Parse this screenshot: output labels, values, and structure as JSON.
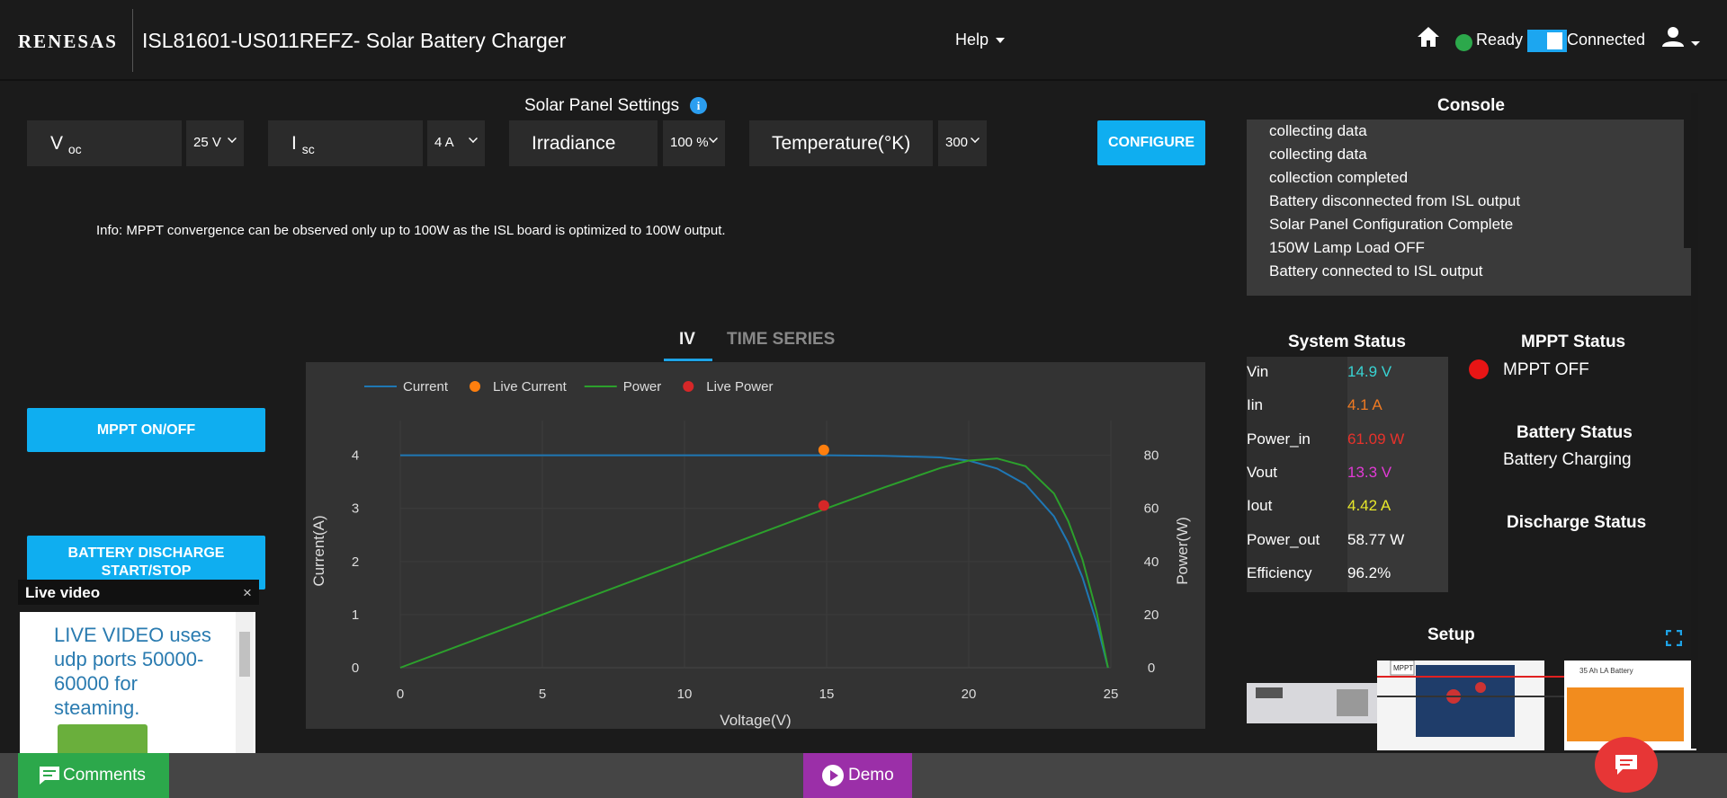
{
  "header": {
    "logo": "RENESAS",
    "title": "ISL81601-US011REFZ- Solar Battery Charger",
    "help_label": "Help",
    "ready_label": "Ready",
    "connected_label": "Connected"
  },
  "panel": {
    "title": "Solar Panel Settings",
    "voc_label": "V",
    "voc_sub": "oc",
    "voc_value": "25 V",
    "isc_label": "I",
    "isc_sub": "sc",
    "isc_value": "4 A",
    "irradiance_label": "Irradiance",
    "irradiance_value": "100 %",
    "temp_label": "Temperature(°K)",
    "temp_value": "300",
    "configure_label": "CONFIGURE",
    "info": "Info: MPPT convergence can be observed only up to 100W as the ISL board is optimized to 100W output."
  },
  "console": {
    "title": "Console",
    "lines": [
      "collecting data",
      "collecting data",
      "collection completed",
      "Battery disconnected from ISL output",
      "Solar Panel Configuration Complete",
      "150W Lamp Load OFF",
      "Battery connected to ISL output"
    ]
  },
  "tabs": {
    "iv": "IV",
    "time_series": "TIME SERIES"
  },
  "buttons": {
    "mppt": "MPPT ON/OFF",
    "discharge_line1": "BATTERY DISCHARGE",
    "discharge_line2": "START/STOP"
  },
  "live_video": {
    "title": "Live video",
    "close": "×",
    "text": "LIVE VIDEO uses udp ports 50000-60000 for steaming."
  },
  "system_status": {
    "title": "System Status",
    "rows": [
      {
        "label": "Vin",
        "value": "14.9 V",
        "color": "#38d4d4"
      },
      {
        "label": "Iin",
        "value": "4.1 A",
        "color": "#f07a22"
      },
      {
        "label": "Power_in",
        "value": "61.09 W",
        "color": "#e8322b"
      },
      {
        "label": "Vout",
        "value": "13.3 V",
        "color": "#e23ad6"
      },
      {
        "label": "Iout",
        "value": "4.42 A",
        "color": "#e8e82a"
      },
      {
        "label": "Power_out",
        "value": "58.77 W",
        "color": "#ffffff"
      },
      {
        "label": "Efficiency",
        "value": "96.2%",
        "color": "#ffffff"
      }
    ]
  },
  "mppt_status": {
    "title": "MPPT Status",
    "value": "MPPT OFF"
  },
  "battery_status": {
    "title": "Battery Status",
    "value": "Battery Charging"
  },
  "discharge_status": {
    "title": "Discharge Status"
  },
  "setup": {
    "title": "Setup",
    "battery_label": "35 Ah LA Battery",
    "mppt_tag": "MPPT"
  },
  "footer": {
    "comments_label": "Comments",
    "demo_label": "Demo"
  },
  "colors": {
    "accent": "#0faef0",
    "current": "#1f77b4",
    "power": "#2ca02c",
    "live_current": "#ff7f0e",
    "live_power": "#d62728"
  },
  "chart_data": {
    "type": "line",
    "xlabel": "Voltage(V)",
    "ylabel": "Current(A)",
    "y2label": "Power(W)",
    "xlim": [
      0,
      25
    ],
    "ylim": [
      0,
      4.4
    ],
    "y2lim": [
      0,
      88
    ],
    "x_ticks": [
      0,
      5,
      10,
      15,
      20,
      25
    ],
    "y_ticks": [
      0,
      1,
      2,
      3,
      4
    ],
    "y2_ticks": [
      0,
      20,
      40,
      60,
      80
    ],
    "legend": [
      "Current",
      "Live Current",
      "Power",
      "Live Power"
    ],
    "series": [
      {
        "name": "Current",
        "axis": "y",
        "x": [
          0,
          5,
          10,
          15,
          17,
          19,
          20,
          21,
          22,
          23,
          23.5,
          24,
          24.5,
          24.9
        ],
        "values": [
          4,
          4,
          4,
          4,
          3.99,
          3.96,
          3.9,
          3.75,
          3.45,
          2.85,
          2.35,
          1.7,
          0.85,
          0
        ]
      },
      {
        "name": "Power",
        "axis": "y2",
        "x": [
          0,
          5,
          10,
          15,
          17,
          19,
          20,
          21,
          22,
          23,
          23.5,
          24,
          24.5,
          24.9
        ],
        "values": [
          0,
          20,
          40,
          60,
          67.8,
          75.2,
          78,
          78.8,
          75.9,
          65.6,
          55.2,
          40.8,
          20.8,
          0
        ]
      },
      {
        "name": "Live Current",
        "axis": "y",
        "x": [
          14.9
        ],
        "values": [
          4.1
        ]
      },
      {
        "name": "Live Power",
        "axis": "y2",
        "x": [
          14.9
        ],
        "values": [
          61.09
        ]
      }
    ]
  }
}
